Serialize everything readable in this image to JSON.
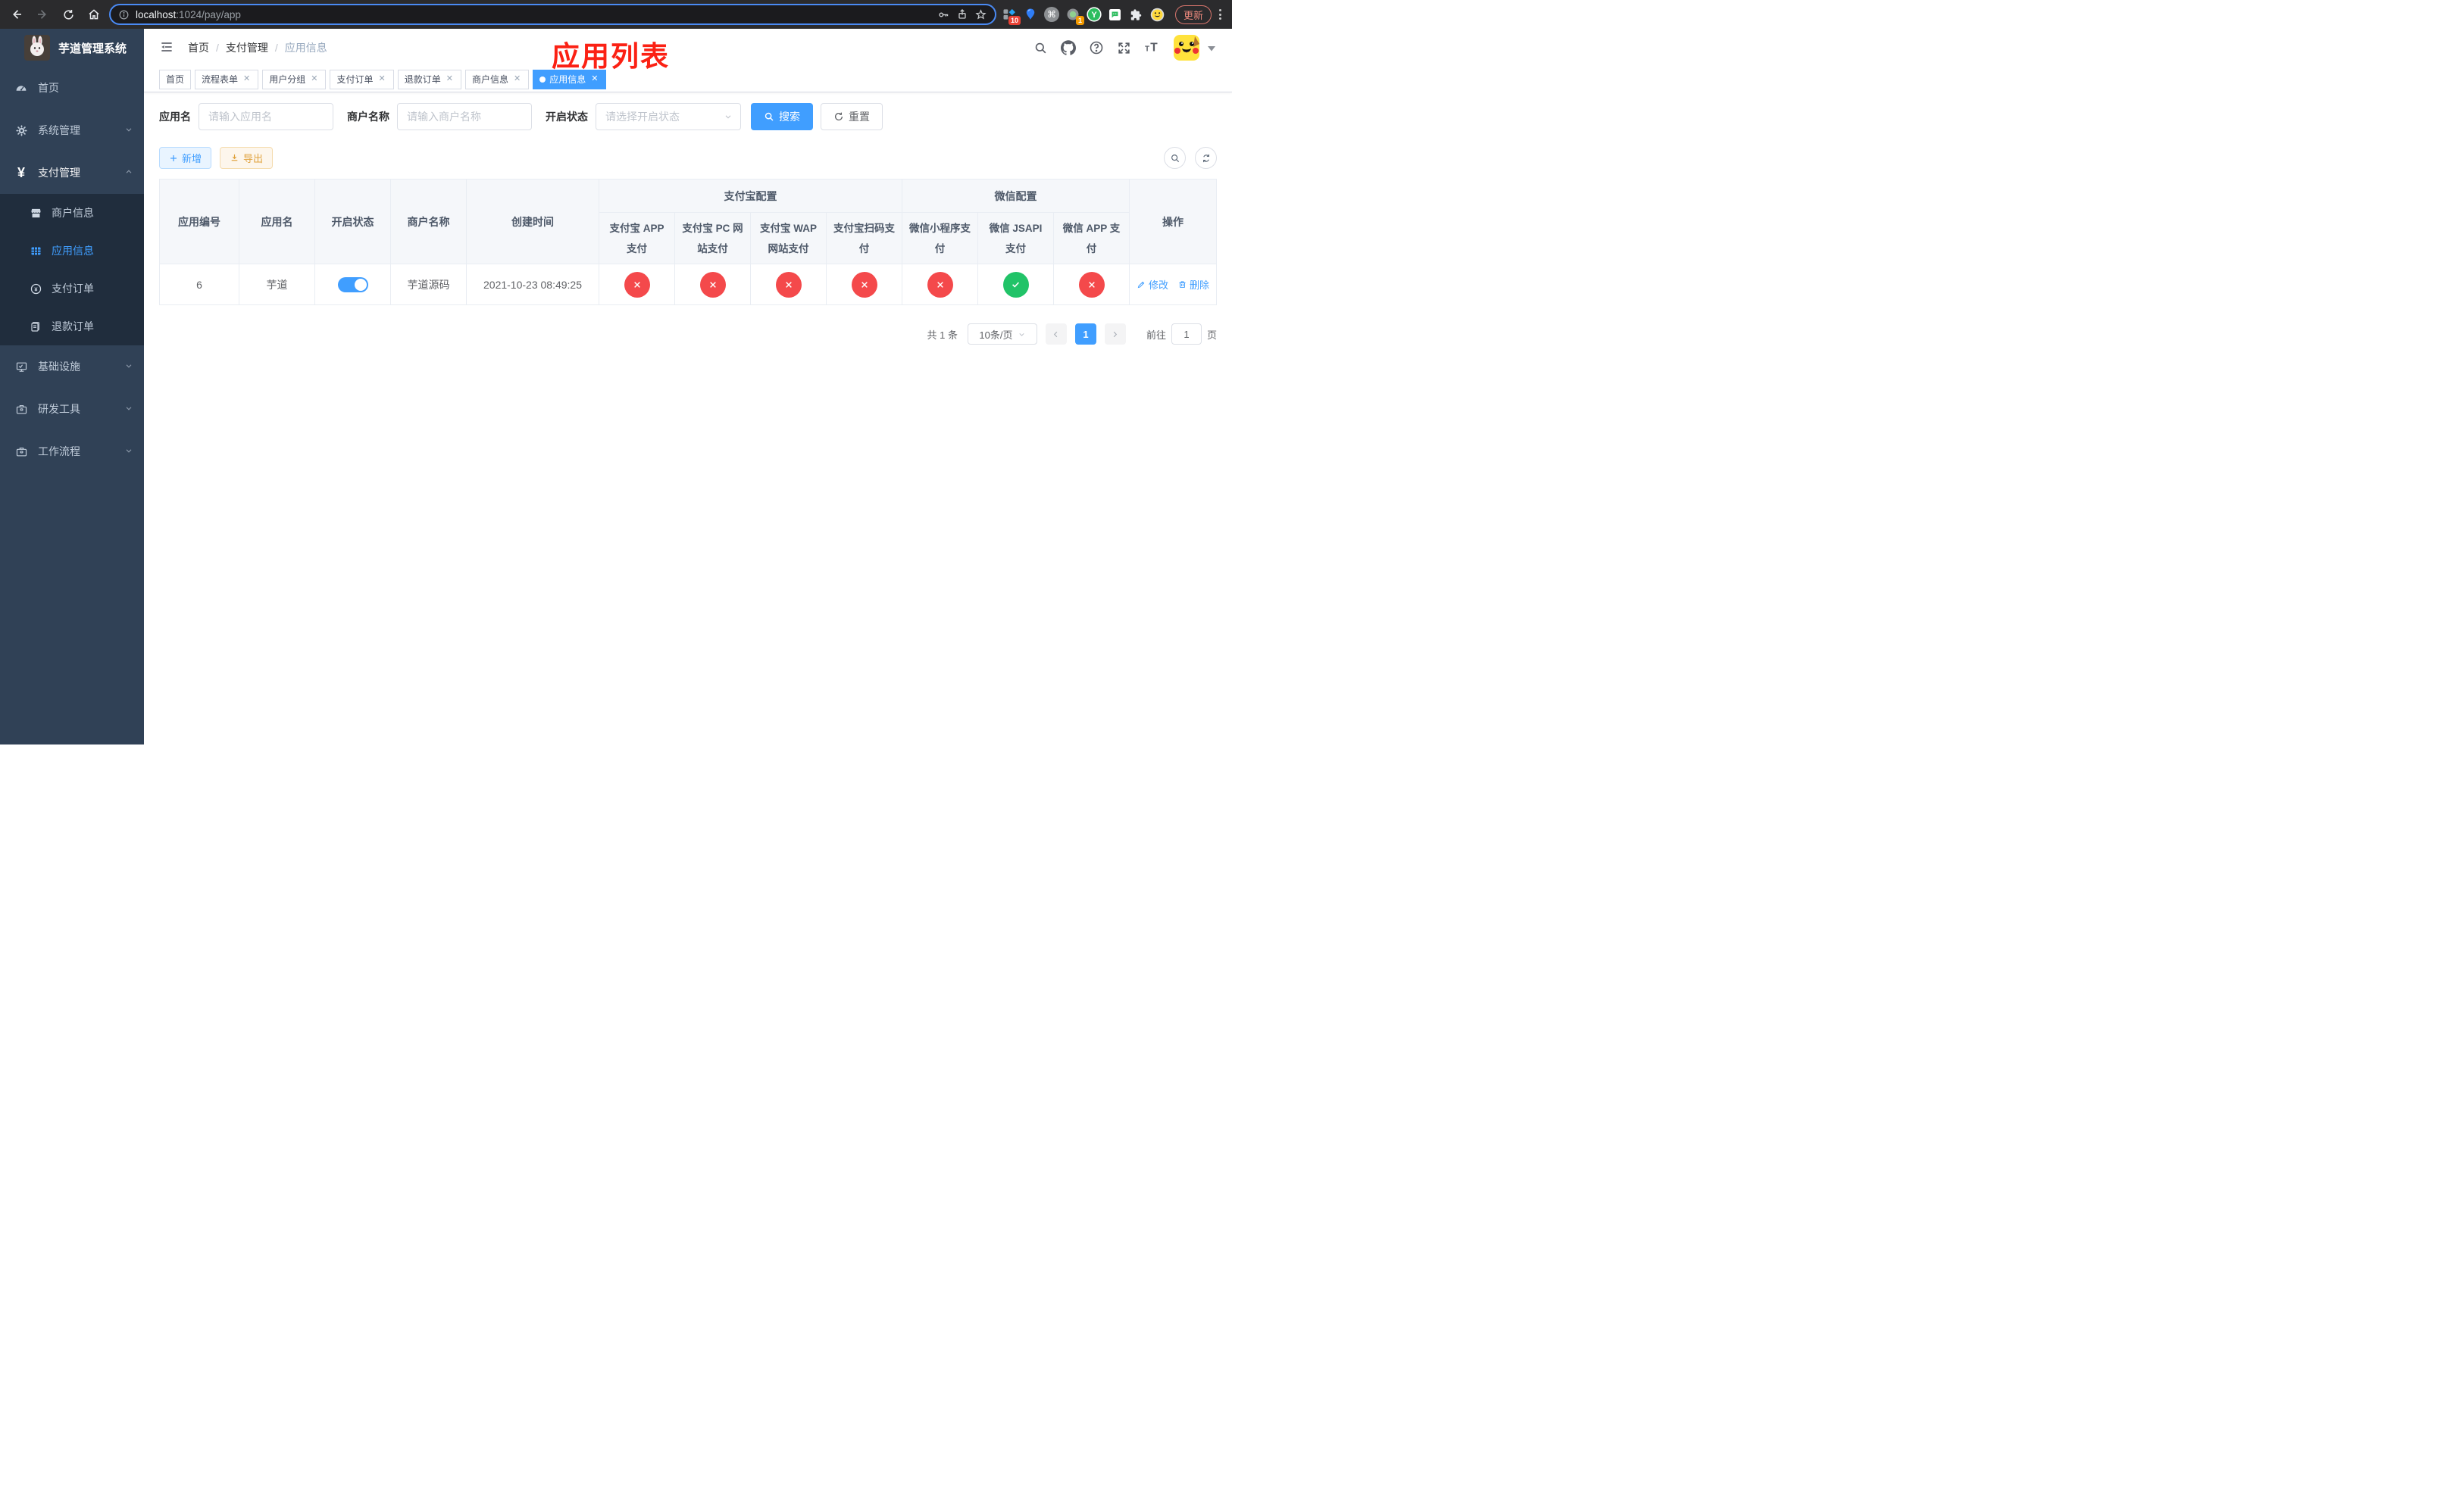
{
  "browser": {
    "url": {
      "host": "localhost",
      "rest": ":1024/pay/app"
    },
    "extensions": {
      "diamond_badge": "10",
      "circle_badge": "1"
    },
    "update_label": "更新"
  },
  "sidebar": {
    "logo_title": "芋道管理系统",
    "items": [
      {
        "label": "首页"
      },
      {
        "label": "系统管理"
      },
      {
        "label": "支付管理"
      },
      {
        "label": "基础设施"
      },
      {
        "label": "研发工具"
      },
      {
        "label": "工作流程"
      }
    ],
    "payment_submenu": [
      {
        "label": "商户信息"
      },
      {
        "label": "应用信息"
      },
      {
        "label": "支付订单"
      },
      {
        "label": "退款订单"
      }
    ]
  },
  "navbar": {
    "breadcrumb": [
      "首页",
      "支付管理",
      "应用信息"
    ],
    "annotation": "应用列表"
  },
  "tabs": [
    {
      "label": "首页"
    },
    {
      "label": "流程表单"
    },
    {
      "label": "用户分组"
    },
    {
      "label": "支付订单"
    },
    {
      "label": "退款订单"
    },
    {
      "label": "商户信息"
    },
    {
      "label": "应用信息"
    }
  ],
  "search": {
    "app_name_label": "应用名",
    "app_name_placeholder": "请输入应用名",
    "merchant_label": "商户名称",
    "merchant_placeholder": "请输入商户名称",
    "status_label": "开启状态",
    "status_placeholder": "请选择开启状态",
    "search_button": "搜索",
    "reset_button": "重置"
  },
  "toolbar": {
    "add_button": "新增",
    "export_button": "导出"
  },
  "table": {
    "headers": {
      "app_id": "应用编号",
      "app_name": "应用名",
      "open_status": "开启状态",
      "merchant_name": "商户名称",
      "create_time": "创建时间",
      "alipay_group": "支付宝配置",
      "wechat_group": "微信配置",
      "actions": "操作"
    },
    "status_columns": [
      {
        "label": "支付宝 APP 支付",
        "enabled": false
      },
      {
        "label": "支付宝 PC 网站支付",
        "enabled": false
      },
      {
        "label": "支付宝 WAP 网站支付",
        "enabled": false
      },
      {
        "label": "支付宝扫码支付",
        "enabled": false
      },
      {
        "label": "微信小程序支付",
        "enabled": false
      },
      {
        "label": "微信 JSAPI 支付",
        "enabled": true
      },
      {
        "label": "微信 APP 支付",
        "enabled": false
      }
    ],
    "row": {
      "app_id": "6",
      "app_name": "芋道",
      "open_status_on": true,
      "merchant_name": "芋道源码",
      "create_time": "2021-10-23 08:49:25",
      "edit_label": "修改",
      "delete_label": "删除"
    }
  },
  "pagination": {
    "total": "共 1 条",
    "page_size": "10条/页",
    "current_page": "1",
    "goto_prefix": "前往",
    "goto_value": "1",
    "goto_suffix": "页"
  },
  "colors": {
    "accent": "#409eff",
    "annotation_red": "#fb2114",
    "status_red": "#f4494b",
    "status_green": "#21c368",
    "sidebar_bg": "#304156",
    "submenu_bg": "#202d3d",
    "warning_orange": "#e0a23c"
  }
}
